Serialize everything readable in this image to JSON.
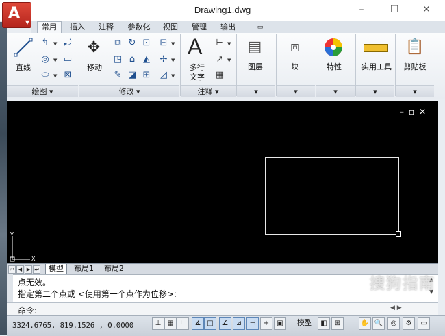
{
  "window": {
    "title": "Drawing1.dwg",
    "min": "–",
    "max": "☐",
    "close": "✕"
  },
  "app_logo": "A",
  "tabs": [
    "常用",
    "插入",
    "注释",
    "参数化",
    "视图",
    "管理",
    "输出"
  ],
  "ribbon": {
    "draw": {
      "line_label": "直线",
      "panel_title": "绘图 ▾"
    },
    "modify": {
      "move_label": "移动",
      "panel_title": "修改 ▾"
    },
    "annotation": {
      "text_label": "多行",
      "text_label2": "文字",
      "panel_title": "注释 ▾"
    },
    "layers": {
      "label": "图层"
    },
    "block": {
      "label": "块"
    },
    "properties": {
      "label": "特性"
    },
    "utilities": {
      "label": "实用工具"
    },
    "clipboard": {
      "label": "剪贴板"
    }
  },
  "viewport_controls": "–▫✕",
  "ucs": {
    "x": "X",
    "y": "Y"
  },
  "layout_tabs": [
    "模型",
    "布局1",
    "布局2"
  ],
  "command": {
    "history": [
      "点无效。",
      "指定第二个点或 <使用第一个点作为位移>:"
    ],
    "prompt": "命令:"
  },
  "status": {
    "coords": "3324.6765, 819.1526 , 0.0000",
    "model": "模型"
  },
  "watermark": "搜狗指南"
}
